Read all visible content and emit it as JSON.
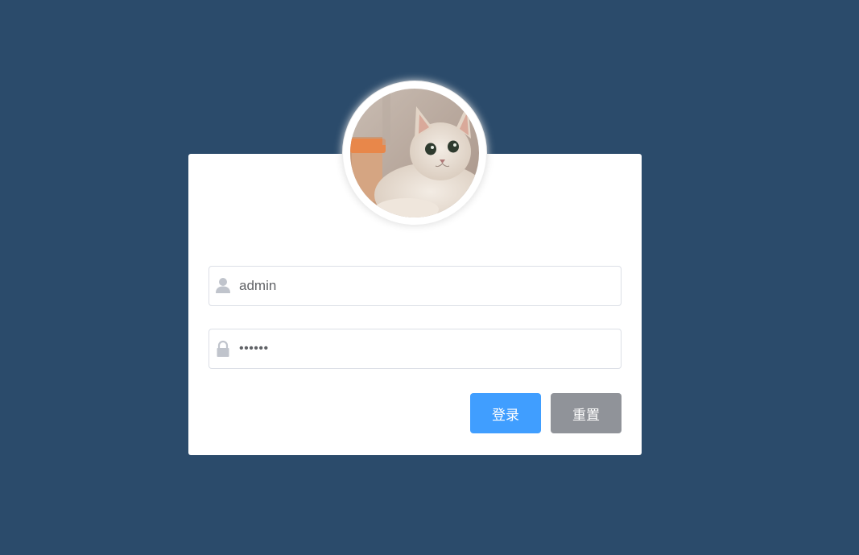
{
  "form": {
    "username": {
      "value": "admin",
      "icon": "user-icon"
    },
    "password": {
      "value": "••••••",
      "icon": "lock-icon"
    }
  },
  "buttons": {
    "login_label": "登录",
    "reset_label": "重置"
  },
  "avatar": {
    "subject": "cat-photo"
  },
  "colors": {
    "page_background": "#2b4b6b",
    "primary": "#409eff",
    "info": "#909399",
    "icon": "#c0c4cc",
    "card": "#ffffff"
  }
}
